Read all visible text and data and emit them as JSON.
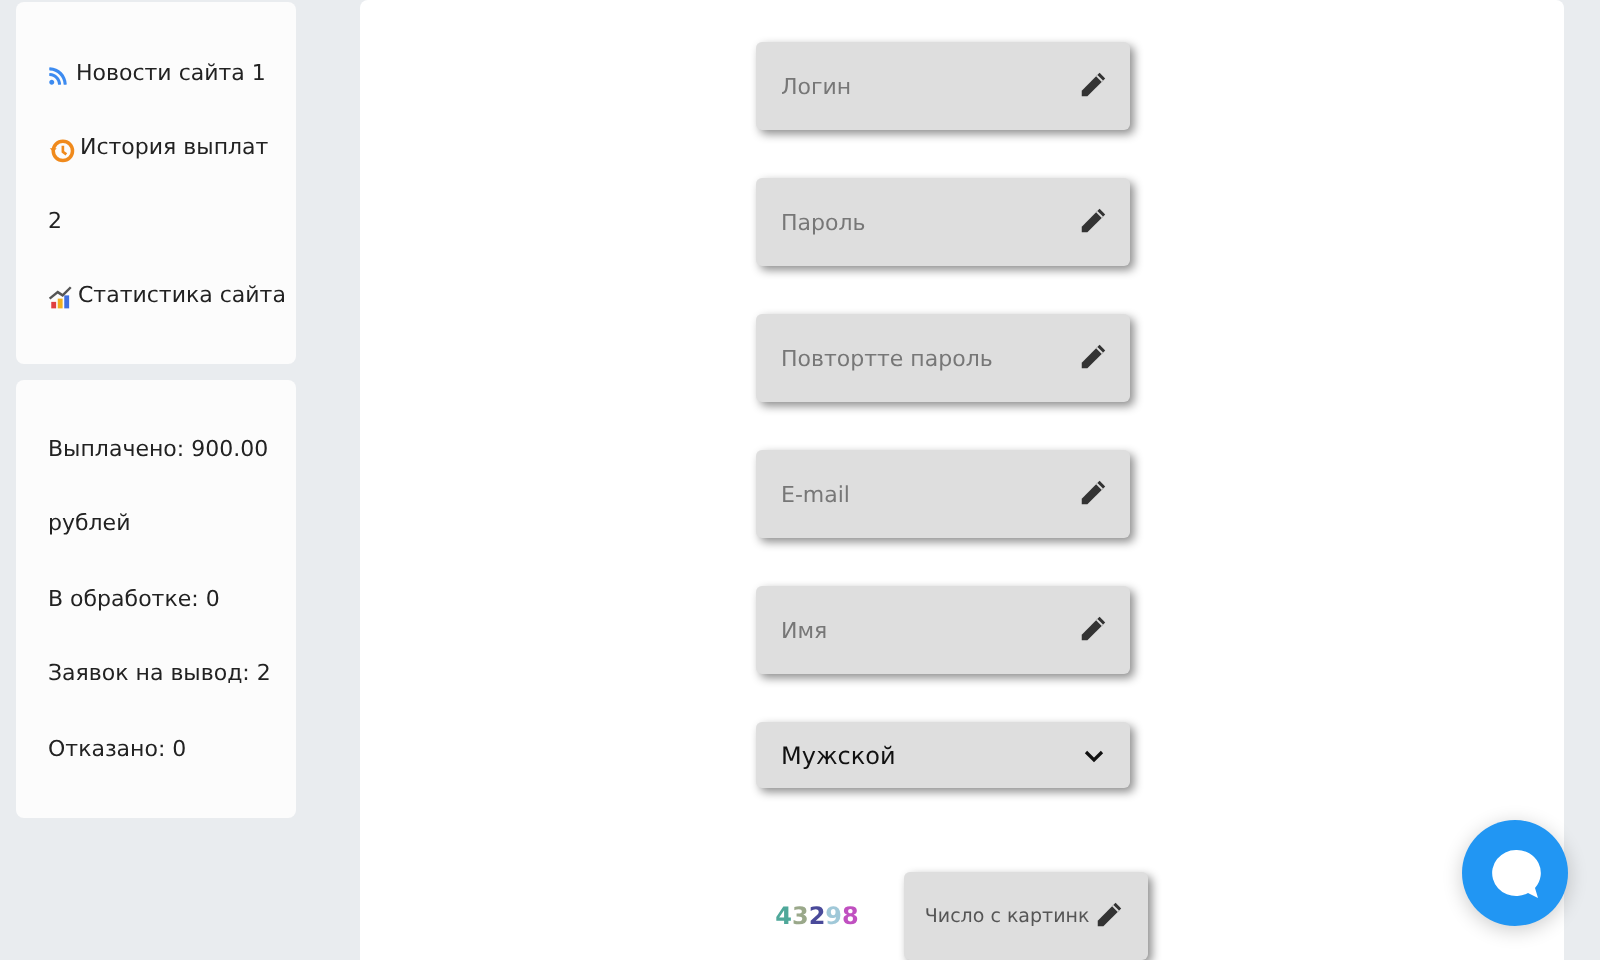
{
  "nav_lines": [
    {
      "kind": "rss",
      "text": "Новости сайта 1"
    },
    {
      "kind": "history",
      "text": "История выплат"
    },
    {
      "kind": "text",
      "text": "2"
    },
    {
      "kind": "chart",
      "text": "Статистика сайта"
    }
  ],
  "stats_lines": [
    "Выплачено: 900.00",
    "рублей",
    "В обработке: 0",
    "Заявок на вывод: 2",
    "Отказано: 0"
  ],
  "form_fields": [
    {
      "kind": "text",
      "placeholder": "Логин"
    },
    {
      "kind": "text",
      "placeholder": "Пароль"
    },
    {
      "kind": "text",
      "placeholder": "Повтортте пароль"
    },
    {
      "kind": "text",
      "placeholder": "E-mail"
    },
    {
      "kind": "text",
      "placeholder": "Имя"
    },
    {
      "kind": "select",
      "value": "Мужской"
    }
  ],
  "captcha": {
    "digits": [
      {
        "text": "4",
        "color": "#4fa89a"
      },
      {
        "text": "3",
        "color": "#9aa88a"
      },
      {
        "text": "2",
        "color": "#4a4a9a"
      },
      {
        "text": "9",
        "color": "#a0c8d8"
      },
      {
        "text": "8",
        "color": "#c050c0"
      }
    ],
    "placeholder": "Число с картинк"
  }
}
